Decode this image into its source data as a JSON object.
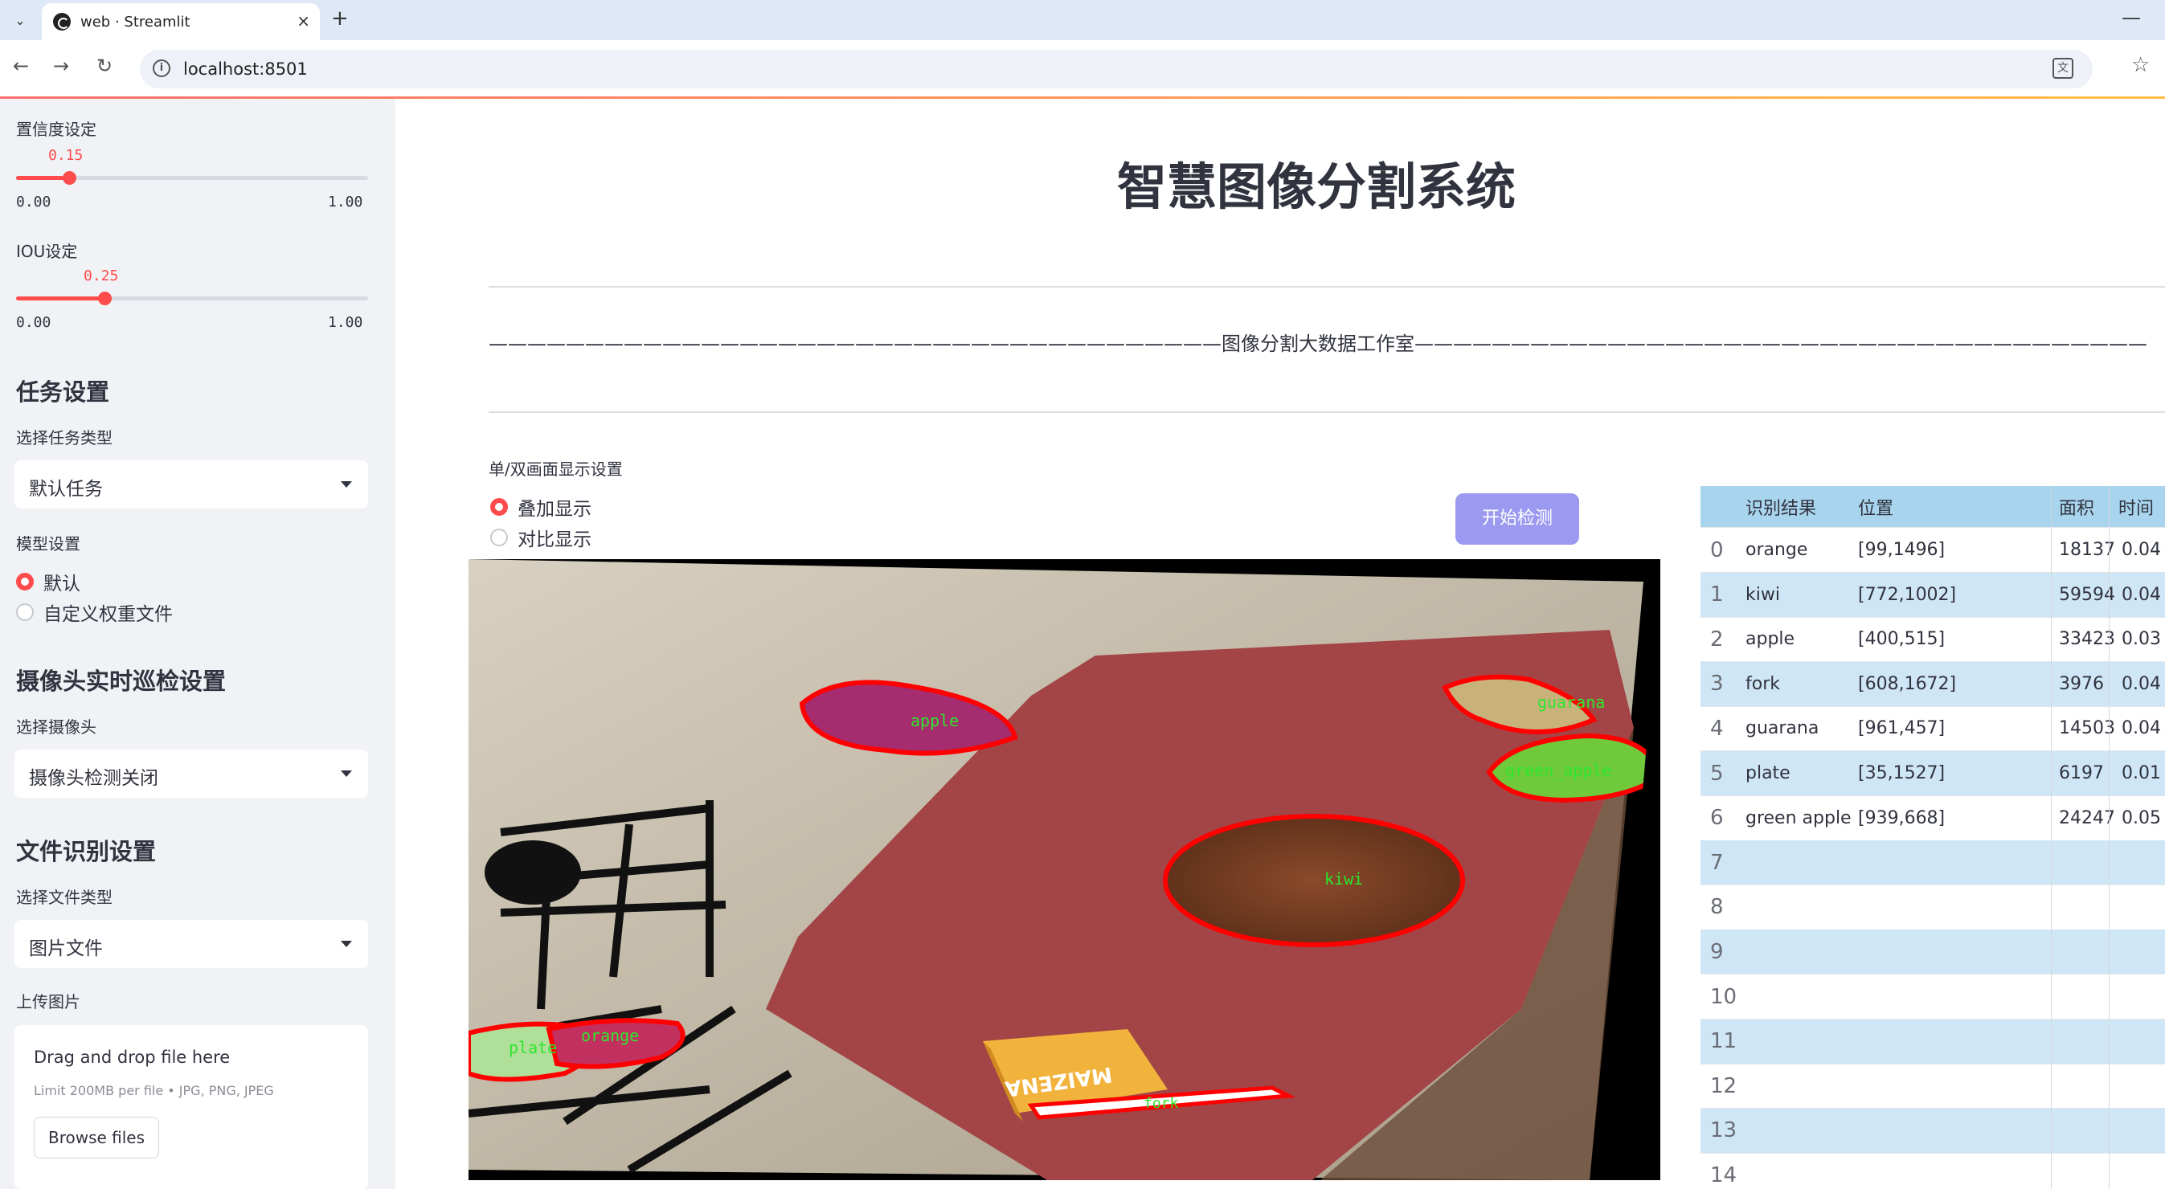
{
  "browser": {
    "tab_title": "web · Streamlit",
    "url": "localhost:8501"
  },
  "sidebar": {
    "confidence": {
      "label": "置信度设定",
      "value": "0.15",
      "min": "0.00",
      "max": "1.00",
      "fraction": 0.15
    },
    "iou": {
      "label": "IOU设定",
      "value": "0.25",
      "min": "0.00",
      "max": "1.00",
      "fraction": 0.25
    },
    "task_section": {
      "title": "任务设置",
      "select_label": "选择任务类型",
      "selected": "默认任务"
    },
    "model_section": {
      "label": "模型设置",
      "options": [
        "默认",
        "自定义权重文件"
      ],
      "selected_index": 0
    },
    "camera_section": {
      "title": "摄像头实时巡检设置",
      "select_label": "选择摄像头",
      "selected": "摄像头检测关闭"
    },
    "file_section": {
      "title": "文件识别设置",
      "select_label": "选择文件类型",
      "selected": "图片文件"
    },
    "upload": {
      "label": "上传图片",
      "drop_text": "Drag and drop file here",
      "limit_text": "Limit 200MB per file • JPG, PNG, JPEG",
      "browse_label": "Browse files"
    }
  },
  "main": {
    "title": "智慧图像分割系统",
    "dash_line": "——————————————————————————————————————图像分割大数据工作室——————————————————————————————————————",
    "display_label": "单/双画面显示设置",
    "display_options": [
      "叠加显示",
      "对比显示"
    ],
    "display_selected_index": 0,
    "start_button": "开始检测",
    "image_labels": {
      "apple": "apple",
      "guarana": "guarana",
      "green_apple": "green_apple",
      "kiwi": "kiwi",
      "orange": "orange",
      "plate": "plate",
      "fork": "fork",
      "box_text": "MAIZENA"
    }
  },
  "table": {
    "headers": [
      "识别结果",
      "位置",
      "面积",
      "时间"
    ],
    "rows": [
      {
        "index": "0",
        "result": "orange",
        "position": "[99,1496]",
        "area": "18137",
        "time": "0.04"
      },
      {
        "index": "1",
        "result": "kiwi",
        "position": "[772,1002]",
        "area": "59594",
        "time": "0.04"
      },
      {
        "index": "2",
        "result": "apple",
        "position": "[400,515]",
        "area": "33423",
        "time": "0.03"
      },
      {
        "index": "3",
        "result": "fork",
        "position": "[608,1672]",
        "area": "3976",
        "time": "0.04"
      },
      {
        "index": "4",
        "result": "guarana",
        "position": "[961,457]",
        "area": "14503",
        "time": "0.04"
      },
      {
        "index": "5",
        "result": "plate",
        "position": "[35,1527]",
        "area": "6197",
        "time": "0.01"
      },
      {
        "index": "6",
        "result": "green apple",
        "position": "[939,668]",
        "area": "24247",
        "time": "0.05"
      },
      {
        "index": "7",
        "result": "",
        "position": "",
        "area": "",
        "time": ""
      },
      {
        "index": "8",
        "result": "",
        "position": "",
        "area": "",
        "time": ""
      },
      {
        "index": "9",
        "result": "",
        "position": "",
        "area": "",
        "time": ""
      },
      {
        "index": "10",
        "result": "",
        "position": "",
        "area": "",
        "time": ""
      },
      {
        "index": "11",
        "result": "",
        "position": "",
        "area": "",
        "time": ""
      },
      {
        "index": "12",
        "result": "",
        "position": "",
        "area": "",
        "time": ""
      },
      {
        "index": "13",
        "result": "",
        "position": "",
        "area": "",
        "time": ""
      },
      {
        "index": "14",
        "result": "",
        "position": "",
        "area": "",
        "time": ""
      }
    ]
  },
  "colors": {
    "accent": "#ff4b4b",
    "button": "#9c99f0",
    "table_header": "#a8d4ee",
    "table_alt": "#cfe6f6",
    "sidebar_bg": "#f0f2f6"
  }
}
